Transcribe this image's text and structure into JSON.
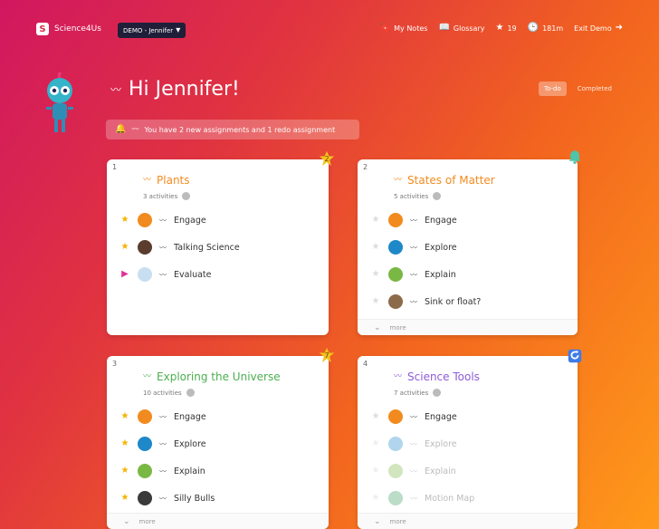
{
  "brand": {
    "name": "Science4Us",
    "logo_letter": "S"
  },
  "demo_label": "DEMO - Jennifer",
  "topnav": {
    "my_notes": "My Notes",
    "glossary": "Glossary",
    "stars": "19",
    "time": "181m",
    "exit": "Exit Demo"
  },
  "greeting": "Hi Jennifer!",
  "notice": "You have 2 new assignments and 1 redo assignment",
  "tabs": {
    "todo": "To-do",
    "completed": "Completed"
  },
  "cards": [
    {
      "number": "1",
      "title": "Plants",
      "color": "#f28b1f",
      "activities": "3 activities",
      "badge": "2",
      "rows": [
        {
          "label": "Engage",
          "status": "star",
          "thumb_color": "#f28b1f",
          "dim": false
        },
        {
          "label": "Talking Science",
          "status": "star",
          "thumb_color": "#5a3d2e",
          "dim": false
        },
        {
          "label": "Evaluate",
          "status": "play",
          "thumb_color": "#c7dff0",
          "dim": false
        }
      ],
      "more": null
    },
    {
      "number": "2",
      "title": "States of Matter",
      "color": "#f28b1f",
      "activities": "5 activities",
      "badge": "",
      "rows": [
        {
          "label": "Engage",
          "status": "empty",
          "thumb_color": "#f28b1f",
          "dim": false
        },
        {
          "label": "Explore",
          "status": "empty",
          "thumb_color": "#1e88c8",
          "dim": false
        },
        {
          "label": "Explain",
          "status": "empty",
          "thumb_color": "#7ab844",
          "dim": false
        },
        {
          "label": "Sink or float?",
          "status": "empty",
          "thumb_color": "#8c6b4a",
          "dim": false
        }
      ],
      "more": "more"
    },
    {
      "number": "3",
      "title": "Exploring the Universe",
      "color": "#4caf50",
      "activities": "10 activities",
      "badge": "7",
      "rows": [
        {
          "label": "Engage",
          "status": "star",
          "thumb_color": "#f28b1f",
          "dim": false
        },
        {
          "label": "Explore",
          "status": "star",
          "thumb_color": "#1e88c8",
          "dim": false
        },
        {
          "label": "Explain",
          "status": "star",
          "thumb_color": "#7ab844",
          "dim": false
        },
        {
          "label": "Silly Bulls",
          "status": "star",
          "thumb_color": "#3a3a3a",
          "dim": false
        }
      ],
      "more": "more"
    },
    {
      "number": "4",
      "title": "Science Tools",
      "color": "#8e5bd6",
      "activities": "7 activities",
      "badge": "",
      "rows": [
        {
          "label": "Engage",
          "status": "empty",
          "thumb_color": "#f28b1f",
          "dim": false
        },
        {
          "label": "Explore",
          "status": "empty",
          "thumb_color": "#1e88c8",
          "dim": true
        },
        {
          "label": "Explain",
          "status": "empty",
          "thumb_color": "#7ab844",
          "dim": true
        },
        {
          "label": "Motion Map",
          "status": "empty",
          "thumb_color": "#3c9a5f",
          "dim": true
        }
      ],
      "more": "more"
    }
  ]
}
